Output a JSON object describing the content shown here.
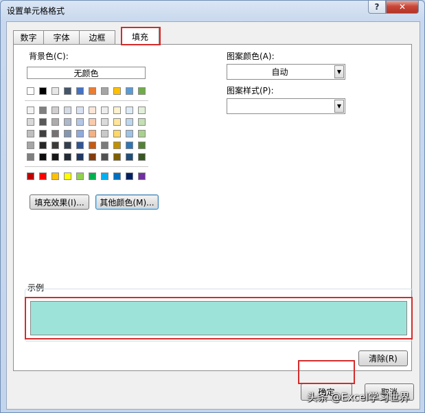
{
  "window": {
    "title": "设置单元格格式",
    "help": "?",
    "close": "✕"
  },
  "tabs": [
    {
      "label": "数字"
    },
    {
      "label": "字体"
    },
    {
      "label": "边框"
    },
    {
      "label": "填充"
    }
  ],
  "fill": {
    "background_label": "背景色(C):",
    "no_color": "无颜色",
    "theme_top": [
      "#ffffff",
      "#000000",
      "#e7e6e6",
      "#44546a",
      "#4472c4",
      "#ed7d31",
      "#a5a5a5",
      "#ffc000",
      "#5b9bd5",
      "#70ad47"
    ],
    "theme_shades": [
      [
        "#f2f2f2",
        "#808080",
        "#d0cece",
        "#d6dce5",
        "#d9e2f3",
        "#fbe5d6",
        "#ededed",
        "#fff2cc",
        "#deebf7",
        "#e2f0d9"
      ],
      [
        "#d9d9d9",
        "#595959",
        "#aeabab",
        "#adb9ca",
        "#b4c7e7",
        "#f8cbad",
        "#dbdbdb",
        "#ffe699",
        "#bdd7ee",
        "#c5e0b4"
      ],
      [
        "#bfbfbf",
        "#404040",
        "#767171",
        "#8497b0",
        "#8faadc",
        "#f4b183",
        "#c9c9c9",
        "#ffd966",
        "#9dc3e6",
        "#a9d18e"
      ],
      [
        "#a6a6a6",
        "#262626",
        "#3b3838",
        "#333f50",
        "#2f5597",
        "#c55a11",
        "#7b7b7b",
        "#bf9000",
        "#2e75b6",
        "#548235"
      ],
      [
        "#7f7f7f",
        "#0d0d0d",
        "#171717",
        "#222a35",
        "#1f3864",
        "#843c0c",
        "#525252",
        "#7f6000",
        "#1f4e79",
        "#385723"
      ]
    ],
    "standard": [
      "#c00000",
      "#ff0000",
      "#ffc000",
      "#ffff00",
      "#92d050",
      "#00b050",
      "#00b0f0",
      "#0070c0",
      "#002060",
      "#7030a0"
    ],
    "fill_effects_button": "填充效果(I)...",
    "more_colors_button": "其他颜色(M)...",
    "pattern_color_label": "图案颜色(A):",
    "pattern_color_value": "自动",
    "pattern_style_label": "图案样式(P):",
    "pattern_style_value": "",
    "sample_label": "示例",
    "sample_color": "#9ee3da",
    "clear_button": "清除(R)"
  },
  "footer": {
    "ok_button": "确定",
    "cancel_button": "取消"
  },
  "watermark": "头条 @Excel学习世界",
  "colors": {
    "highlight": "#d32b2b"
  }
}
